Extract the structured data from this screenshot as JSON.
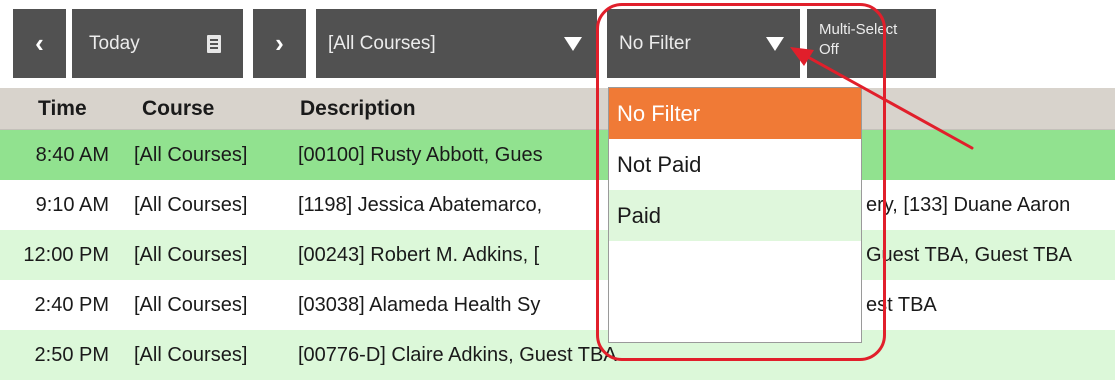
{
  "toolbar": {
    "prev_icon": "chevron-left-icon",
    "prev_glyph": "‹",
    "date_label": "Today",
    "calendar_icon": "calendar-icon",
    "next_icon": "chevron-right-icon",
    "next_glyph": "›",
    "course_select": {
      "value": "[All Courses]"
    },
    "filter_select": {
      "value": "No Filter"
    },
    "multi_select": {
      "line1": "Multi-Select",
      "line2": "Off"
    }
  },
  "table": {
    "columns": [
      "Time",
      "Course",
      "Description"
    ],
    "rows": [
      {
        "time": "8:40 AM",
        "course": "[All Courses]",
        "description": "[00100] Rusty Abbott, Gues"
      },
      {
        "time": "9:10 AM",
        "course": "[All Courses]",
        "description": "[1198] Jessica Abatemarco,",
        "description_tail": "ery, [133] Duane Aaron"
      },
      {
        "time": "12:00 PM",
        "course": "[All Courses]",
        "description": "[00243] Robert M. Adkins, [",
        "description_tail": "Guest TBA, Guest TBA"
      },
      {
        "time": "2:40 PM",
        "course": "[All Courses]",
        "description": "[03038]  Alameda Health Sy",
        "description_tail": "est TBA"
      },
      {
        "time": "2:50 PM",
        "course": "[All Courses]",
        "description": "[00776-D] Claire Adkins, Guest TBA"
      }
    ]
  },
  "filter_dropdown": {
    "options": [
      "No Filter",
      "Not Paid",
      "Paid"
    ],
    "selected": "No Filter"
  },
  "annotation": {
    "color": "#e11f2b"
  },
  "colors": {
    "toolbar_button": "#515151",
    "header_bg": "#d8d3cc",
    "row_green": "#91e28f",
    "row_light_green": "#dcf8d9",
    "selected_option": "#f07a36"
  }
}
